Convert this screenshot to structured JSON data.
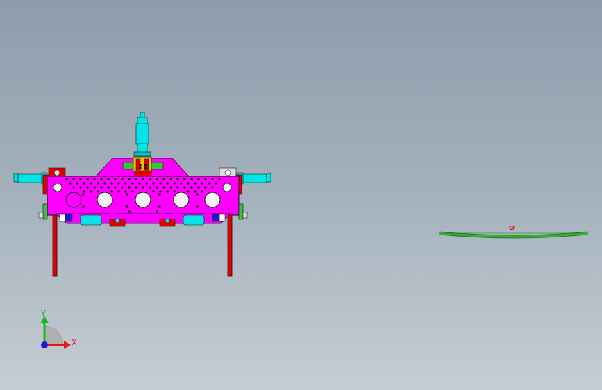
{
  "viewport": {
    "background_top": "#8d9cac",
    "background_bottom": "#c6cdd3"
  },
  "colors": {
    "plate": "#ff00ff",
    "cylinder": "#00e5e5",
    "clamp_red": "#e10000",
    "support_green": "#39c339",
    "blank_green": "#2fb52f",
    "edge": "#111111"
  },
  "triad": {
    "y_label": "Y",
    "x_label": "X",
    "y_color": "#16b816",
    "x_color": "#e51616",
    "z_color": "#1a1ad0"
  },
  "blank_part": {
    "icon": "part-outline-icon"
  }
}
